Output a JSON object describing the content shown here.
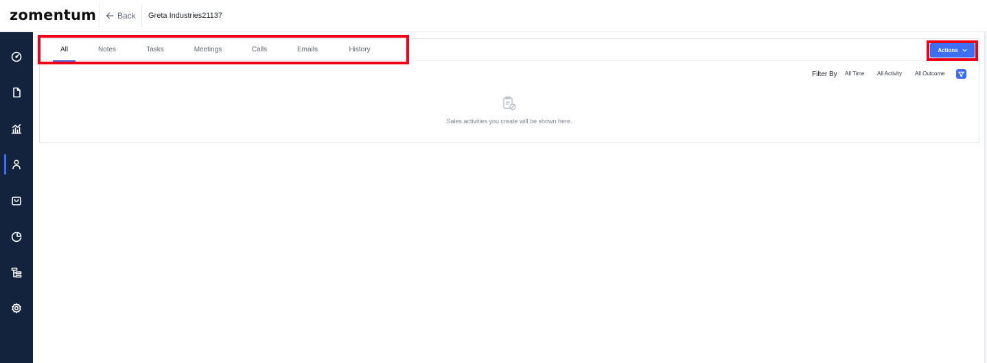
{
  "header": {
    "logo": "zomentum",
    "back_label": "Back",
    "breadcrumb": "Greta Industries21137"
  },
  "sidebar": {
    "items": [
      {
        "icon": "dashboard-gauge-icon"
      },
      {
        "icon": "document-icon"
      },
      {
        "icon": "analytics-icon"
      },
      {
        "icon": "user-icon",
        "active": true
      },
      {
        "icon": "shopping-bag-icon"
      },
      {
        "icon": "pie-chart-icon"
      },
      {
        "icon": "hierarchy-icon"
      },
      {
        "icon": "settings-gear-icon"
      }
    ]
  },
  "tabs": [
    {
      "label": "All",
      "active": true
    },
    {
      "label": "Notes"
    },
    {
      "label": "Tasks"
    },
    {
      "label": "Meetings"
    },
    {
      "label": "Calls"
    },
    {
      "label": "Emails"
    },
    {
      "label": "History"
    }
  ],
  "actions": {
    "label": "Actions",
    "icon": "chevron-down-icon"
  },
  "filter": {
    "label": "Filter By",
    "time": "All Time",
    "activity": "All Activity",
    "outcome": "All Outcome",
    "icon": "filter-funnel-icon"
  },
  "empty_state": {
    "icon": "clipboard-empty-icon",
    "message": "Sales activities you create will be shown here."
  },
  "colors": {
    "sidebar_bg": "#13233e",
    "accent": "#3d6ff5",
    "highlight": "#f00018"
  }
}
